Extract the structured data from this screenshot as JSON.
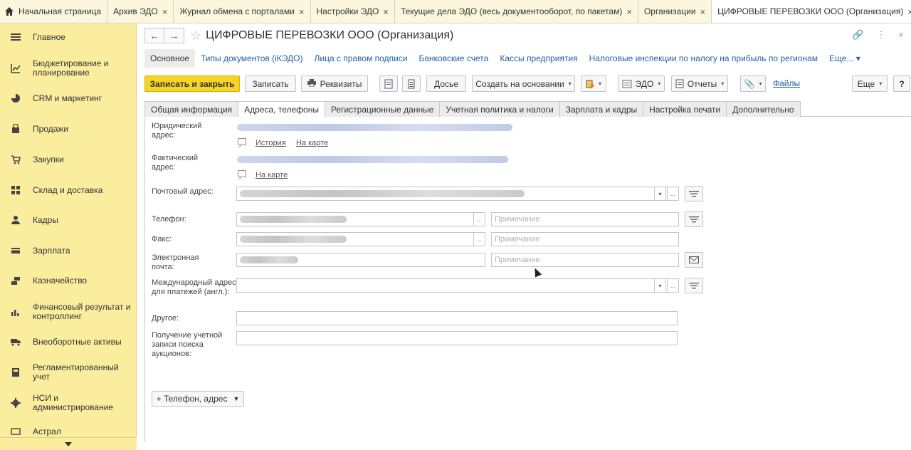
{
  "top_tabs": [
    {
      "label": "Начальная страница",
      "closable": false
    },
    {
      "label": "Архив ЭДО",
      "closable": true
    },
    {
      "label": "Журнал обмена с порталами",
      "closable": true
    },
    {
      "label": "Настройки ЭДО",
      "closable": true
    },
    {
      "label": "Текущие дела ЭДО (весь документооборот, по пакетам)",
      "closable": true
    },
    {
      "label": "Организации",
      "closable": true
    },
    {
      "label": "ЦИФРОВЫЕ ПЕРЕВОЗКИ ООО (Организация)",
      "closable": true,
      "active": true
    }
  ],
  "close_glyph": "×",
  "sidebar": {
    "items": [
      {
        "label": "Главное",
        "icon": "menu-icon"
      },
      {
        "label": "Бюджетирование и планирование",
        "icon": "budget-icon"
      },
      {
        "label": "CRM и маркетинг",
        "icon": "crm-icon"
      },
      {
        "label": "Продажи",
        "icon": "bag-icon"
      },
      {
        "label": "Закупки",
        "icon": "cart-icon"
      },
      {
        "label": "Склад и доставка",
        "icon": "warehouse-icon"
      },
      {
        "label": "Кадры",
        "icon": "person-icon"
      },
      {
        "label": "Зарплата",
        "icon": "wallet-icon"
      },
      {
        "label": "Казначейство",
        "icon": "treasury-icon"
      },
      {
        "label": "Финансовый результат и контроллинг",
        "icon": "chart-icon"
      },
      {
        "label": "Внеоборотные активы",
        "icon": "truck-icon"
      },
      {
        "label": "Регламентированный учет",
        "icon": "calculator-icon"
      },
      {
        "label": "НСИ и администрирование",
        "icon": "gear-icon"
      },
      {
        "label": "Астрал",
        "icon": "astral-icon"
      }
    ]
  },
  "header": {
    "title": "ЦИФРОВЫЕ ПЕРЕВОЗКИ ООО (Организация)",
    "back_glyph": "←",
    "forward_glyph": "→"
  },
  "subnav": {
    "items": [
      "Основное",
      "Типы документов (iКЭДО)",
      "Лица с правом подписи",
      "Банковские счета",
      "Кассы предприятия",
      "Налоговые инспекции по налогу на прибыль по регионам"
    ],
    "more": "Еще..."
  },
  "toolbar": {
    "save_close": "Записать и закрыть",
    "save": "Записать",
    "requisites": "Реквизиты",
    "dossier": "Досье",
    "create_based": "Создать на основании",
    "edo": "ЭДО",
    "reports": "Отчеты",
    "files": "Файлы",
    "more": "Еще",
    "help": "?"
  },
  "form_tabs": [
    "Общая информация",
    "Адреса, телефоны",
    "Регистрационные данные",
    "Учетная политика и налоги",
    "Зарплата и кадры",
    "Настройка печати",
    "Дополнительно"
  ],
  "form": {
    "legal_address_label": "Юридический адрес:",
    "history_link": "История",
    "map_link": "На карте",
    "actual_address_label": "Фактический адрес:",
    "actual_map_link": "На карте",
    "postal_address_label": "Почтовый адрес:",
    "phone_label": "Телефон:",
    "fax_label": "Факс:",
    "email_label": "Электронная почта:",
    "intl_address_label": "Международный адрес для платежей (англ.):",
    "other_label": "Другое:",
    "auction_label": "Получение учетной записи поиска аукционов:",
    "note_placeholder": "Примечание",
    "ellipsis": "...",
    "add_contact_button": "+ Телефон, адрес"
  }
}
